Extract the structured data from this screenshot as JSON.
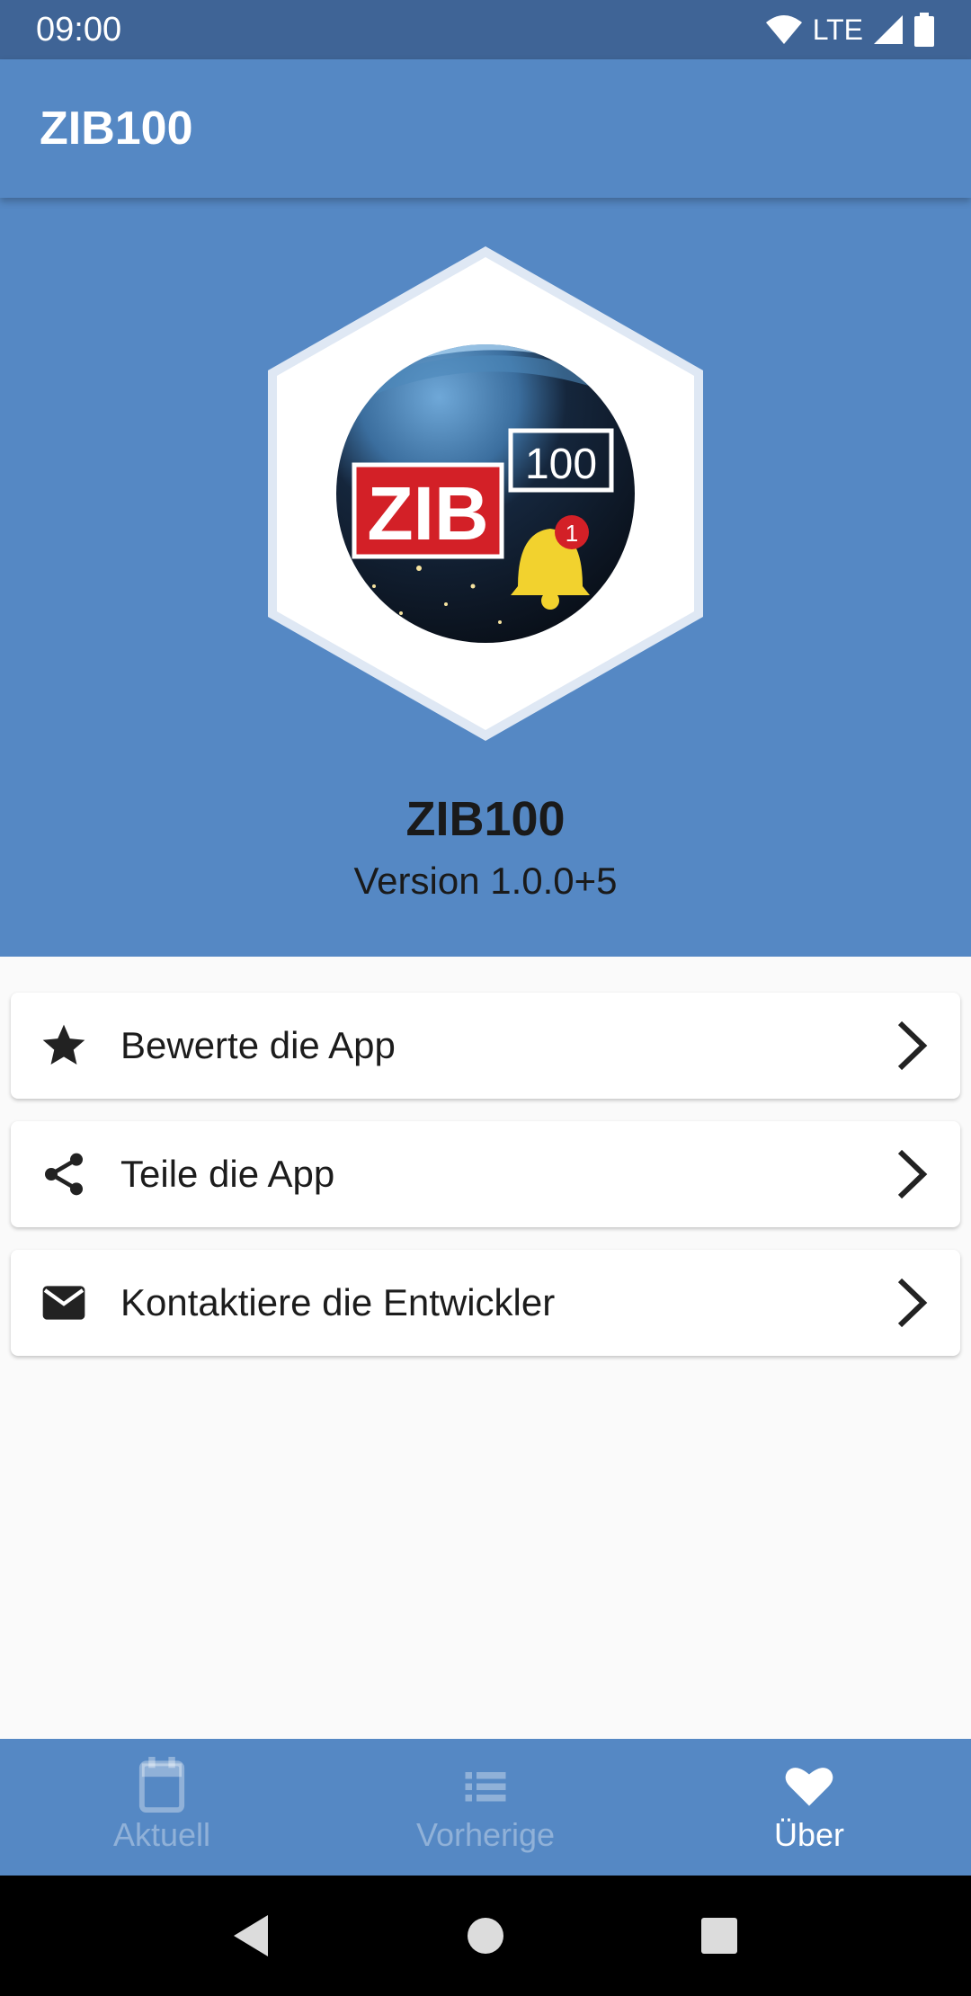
{
  "status_bar": {
    "time": "09:00",
    "network": "LTE",
    "icons": [
      "wifi-icon",
      "signal-icon",
      "battery-icon"
    ]
  },
  "app_bar": {
    "title": "ZIB100"
  },
  "hero": {
    "logo": {
      "badge_text": "ZIB",
      "tag_text": "100",
      "notification_count": "1"
    },
    "app_name": "ZIB100",
    "version": "Version 1.0.0+5"
  },
  "menu": [
    {
      "label": "Bewerte die App",
      "icon": "star-icon"
    },
    {
      "label": "Teile die App",
      "icon": "share-icon"
    },
    {
      "label": "Kontaktiere die Entwickler",
      "icon": "mail-icon"
    }
  ],
  "bottom_nav": [
    {
      "label": "Aktuell",
      "icon": "calendar-icon",
      "active": false
    },
    {
      "label": "Vorherige",
      "icon": "list-icon",
      "active": false
    },
    {
      "label": "Über",
      "icon": "heart-icon",
      "active": true
    }
  ],
  "colors": {
    "status_bar": "#3f6496",
    "primary": "#5588c4",
    "background": "#fafafa",
    "text": "#1a1a1a",
    "brand_red": "#d32027",
    "bell_yellow": "#f2d22e"
  }
}
